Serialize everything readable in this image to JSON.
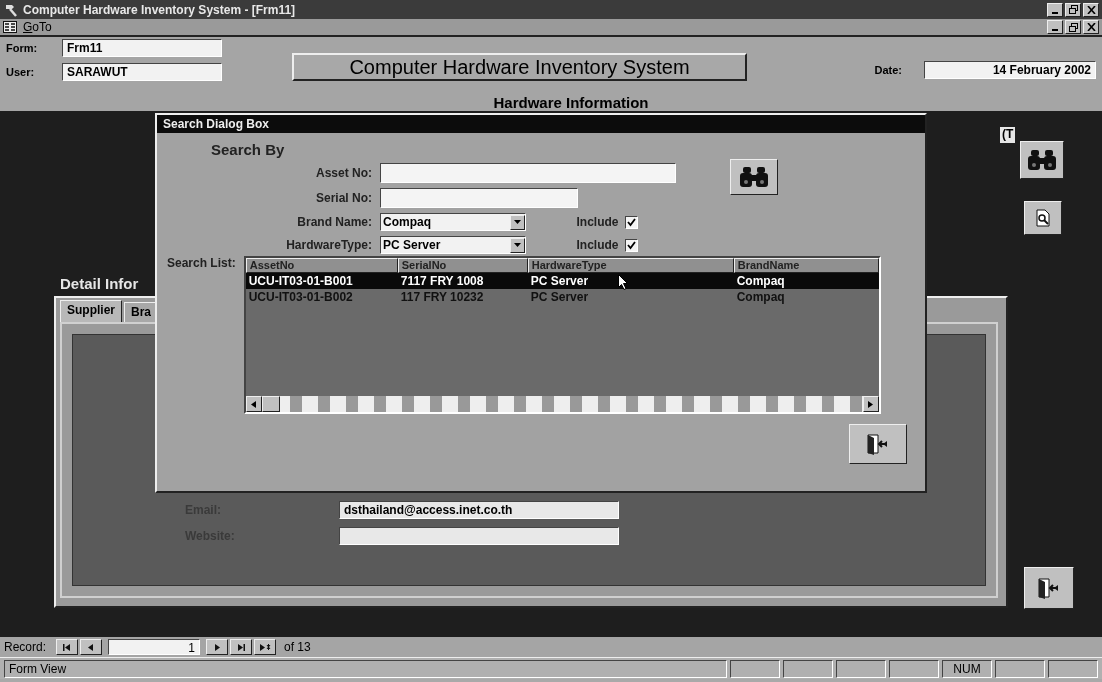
{
  "window": {
    "title": "Computer Hardware Inventory System - [Frm11]"
  },
  "menu": [
    {
      "label": "GoTo"
    }
  ],
  "header": {
    "form_label": "Form:",
    "form_value": "Frm11",
    "user_label": "User:",
    "user_value": "SARAWUT",
    "title": "Computer Hardware Inventory System",
    "subtitle": "Hardware Information",
    "date_label": "Date:",
    "date_value": "14 February 2002"
  },
  "side_fragment": "(T",
  "detail": {
    "heading": "Detail Infor",
    "tabs": [
      {
        "label": "Supplier",
        "selected": true
      },
      {
        "label": "Bra",
        "selected": false
      }
    ],
    "fields": [
      {
        "label": "Email:",
        "value": "dsthailand@access.inet.co.th"
      },
      {
        "label": "Website:"
      }
    ]
  },
  "record_nav": {
    "label": "Record:",
    "current": "1",
    "total": "of 13"
  },
  "status_bar": {
    "text": "Form View",
    "indicators": [
      "NUM"
    ]
  },
  "dialog": {
    "title": "Search Dialog Box",
    "heading": "Search By",
    "fields": [
      {
        "kind": "text",
        "label": "Asset No:"
      },
      {
        "kind": "text",
        "label": "Serial No:"
      },
      {
        "kind": "combo",
        "label": "Brand Name:",
        "value": "Compaq",
        "include_label": "Include",
        "include": true
      },
      {
        "kind": "combo",
        "label": "HardwareType:",
        "value": "PC Server",
        "include_label": "Include",
        "include": true
      }
    ],
    "list_label": "Search List:",
    "columns": [
      "AssetNo",
      "SerialNo",
      "HardwareType",
      "BrandName"
    ],
    "rows": [
      {
        "cells": [
          "UCU-IT03-01-B001",
          "7117 FRY 1008",
          "PC Server",
          "Compaq"
        ],
        "selected": true
      },
      {
        "cells": [
          "UCU-IT03-01-B002",
          "117 FRY 10232",
          "PC Server",
          "Compaq"
        ],
        "selected": false
      }
    ]
  }
}
